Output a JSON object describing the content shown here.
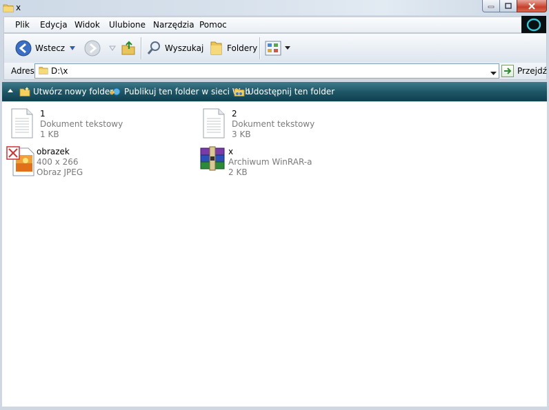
{
  "window": {
    "title": "x"
  },
  "menu": [
    "Plik",
    "Edycja",
    "Widok",
    "Ulubione",
    "Narzędzia",
    "Pomoc"
  ],
  "toolbar": {
    "back_label": "Wstecz",
    "search_label": "Wyszukaj",
    "folders_label": "Foldery"
  },
  "address": {
    "label": "Adres",
    "value": "D:\\x",
    "go_label": "Przejdź"
  },
  "tasks": {
    "new_folder": "Utwórz nowy folder",
    "publish": "Publikuj ten folder w sieci Web",
    "share": "Udostępnij ten folder"
  },
  "files": [
    {
      "name": "1",
      "line1": "Dokument tekstowy",
      "line2": "1 KB",
      "icon": "text-file-icon"
    },
    {
      "name": "2",
      "line1": "Dokument tekstowy",
      "line2": "3 KB",
      "icon": "text-file-icon"
    },
    {
      "name": "obrazek",
      "line1": "400 x 266",
      "line2": "Obraz JPEG",
      "icon": "jpeg-image-icon"
    },
    {
      "name": "x",
      "line1": "Archiwum WinRAR-a",
      "line2": "2 KB",
      "icon": "winrar-archive-icon"
    }
  ],
  "colors": {
    "taskbar": "#1f5767",
    "secondary_text": "#7a7a7a",
    "address_border": "#7f9db9"
  }
}
